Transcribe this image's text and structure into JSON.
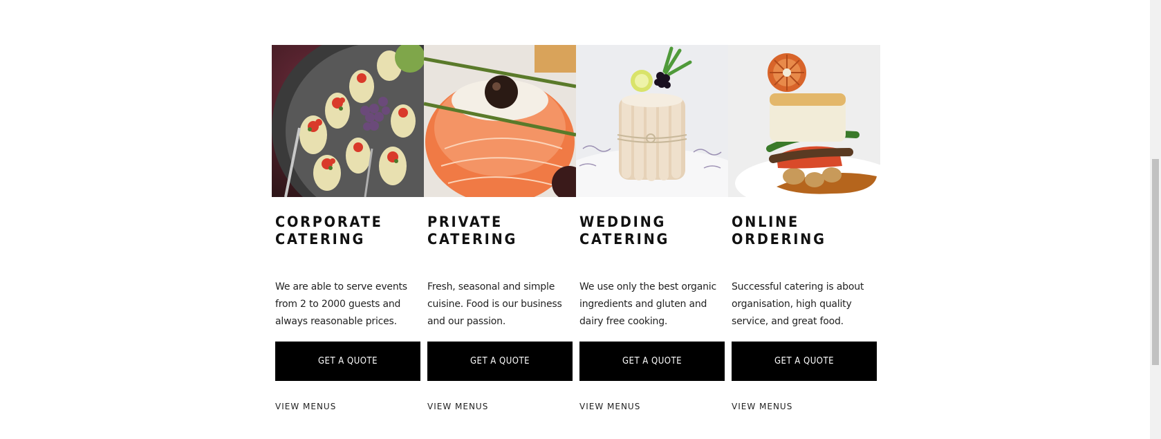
{
  "services": [
    {
      "title_line1": "CORPORATE",
      "title_line2": "CATERING",
      "description": "We are able to serve events from 2 to 2000 guests and always reasonable prices.",
      "button_label": "GET A QUOTE",
      "link_label": "VIEW MENUS"
    },
    {
      "title_line1": "PRIVATE",
      "title_line2": "CATERING",
      "description": "Fresh, seasonal and simple cuisine. Food is our business and our passion.",
      "button_label": "GET A QUOTE",
      "link_label": "VIEW MENUS"
    },
    {
      "title_line1": "WEDDING",
      "title_line2": "CATERING",
      "description": "We use only the best organic ingredients and gluten and dairy free cooking.",
      "button_label": "GET A QUOTE",
      "link_label": "VIEW MENUS"
    },
    {
      "title_line1": "ONLINE",
      "title_line2": "ORDERING",
      "description": "Successful catering is about organisation, high quality service, and great food.",
      "button_label": "GET A QUOTE",
      "link_label": "VIEW MENUS"
    }
  ],
  "colors": {
    "button_bg": "#000000",
    "button_text": "#ffffff",
    "title": "#111111",
    "body_text": "#222222"
  }
}
